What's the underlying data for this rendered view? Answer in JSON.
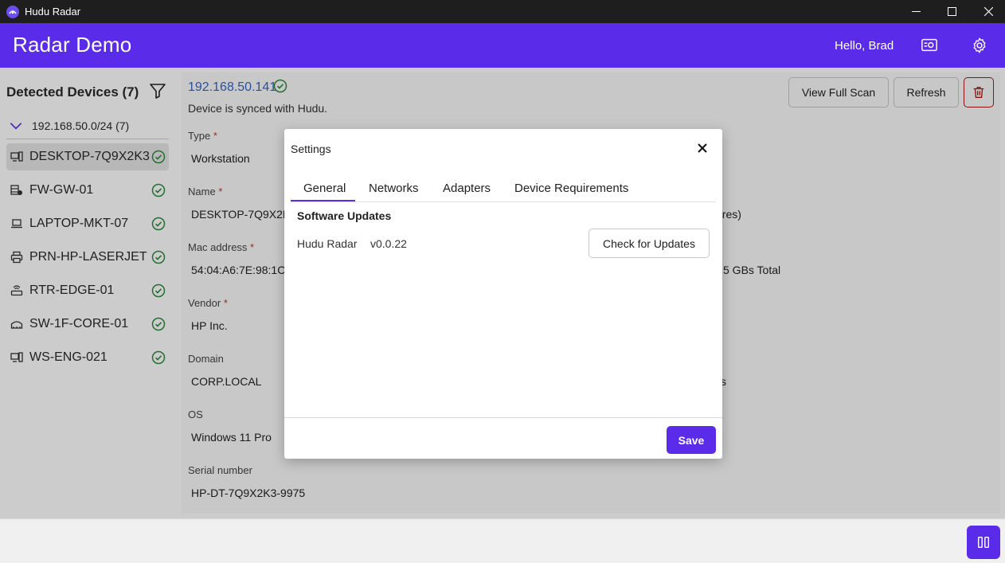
{
  "window": {
    "title": "Hudu Radar",
    "controls": [
      "minimize-icon",
      "maximize-icon",
      "close-icon"
    ]
  },
  "header": {
    "app_name": "Radar Demo",
    "greeting": "Hello, Brad",
    "icons": [
      "license-icon",
      "gear-icon"
    ],
    "accent_color": "#5b2bea"
  },
  "sidebar": {
    "title": "Detected Devices (7)",
    "network": "192.168.50.0/24 (7)",
    "devices": [
      {
        "name": "DESKTOP-7Q9X2K3",
        "icon": "workstation-icon",
        "selected": true
      },
      {
        "name": "FW-GW-01",
        "icon": "firewall-icon"
      },
      {
        "name": "LAPTOP-MKT-07",
        "icon": "laptop-icon"
      },
      {
        "name": "PRN-HP-LASERJET",
        "icon": "printer-icon"
      },
      {
        "name": "RTR-EDGE-01",
        "icon": "router-icon"
      },
      {
        "name": "SW-1F-CORE-01",
        "icon": "switch-icon"
      },
      {
        "name": "WS-ENG-021",
        "icon": "workstation-icon"
      }
    ]
  },
  "detail": {
    "ip": "192.168.50.141",
    "sync_status": "Device is synced with Hudu.",
    "buttons": {
      "view_full_scan": "View Full Scan",
      "refresh": "Refresh"
    },
    "fields": {
      "type": {
        "label": "Type",
        "value": "Workstation"
      },
      "name": {
        "label": "Name",
        "value": "DESKTOP-7Q9X2K"
      },
      "mac": {
        "label": "Mac address",
        "value": "54:04:A6:7E:98:1C"
      },
      "vendor": {
        "label": "Vendor",
        "value": "HP Inc."
      },
      "domain": {
        "label": "Domain",
        "value": "CORP.LOCAL"
      },
      "os": {
        "label": "OS",
        "value": "Windows 11 Pro"
      },
      "serial": {
        "label": "Serial number",
        "value": "HP-DT-7Q9X2K3-9975"
      }
    },
    "right_partial": {
      "cores": "ores)",
      "memory": "5 GBs Total",
      "domain_tail": "s"
    },
    "required_mark": "*"
  },
  "modal": {
    "title": "Settings",
    "tabs": [
      "General",
      "Networks",
      "Adapters",
      "Device Requirements"
    ],
    "active_tab": "General",
    "section_title": "Software Updates",
    "product_name": "Hudu Radar",
    "version": "v0.0.22",
    "check_button": "Check for Updates",
    "save_button": "Save"
  }
}
